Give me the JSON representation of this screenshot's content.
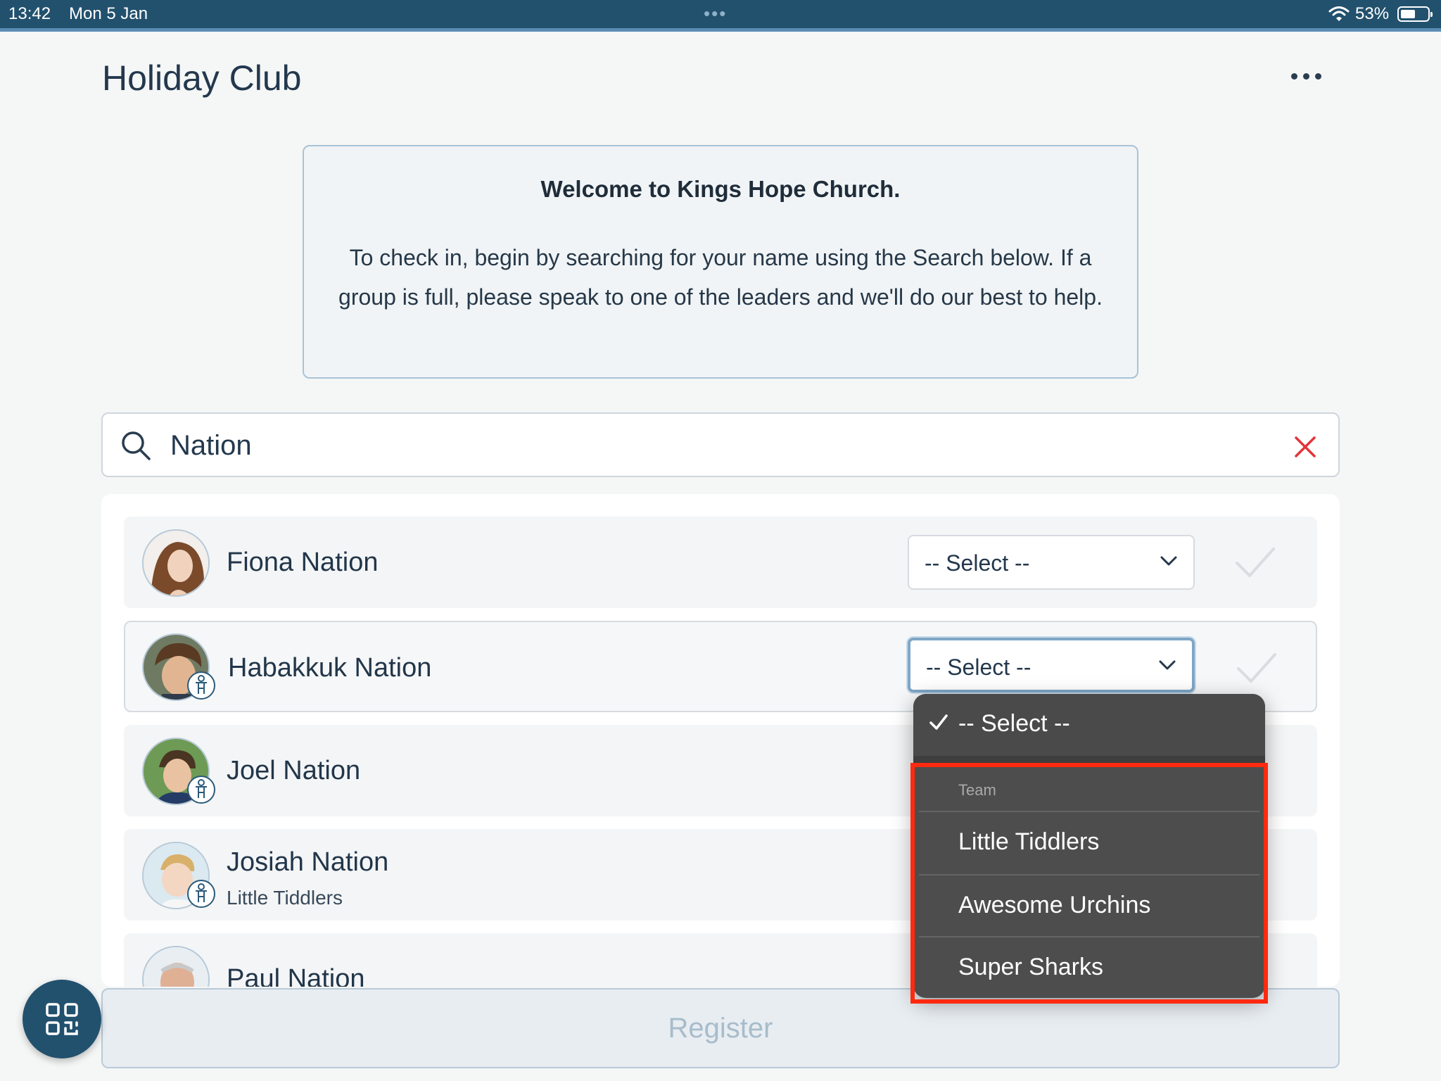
{
  "status_bar": {
    "time": "13:42",
    "date": "Mon 5 Jan",
    "battery": "53%",
    "battery_level": 0.53
  },
  "header": {
    "title": "Holiday Club"
  },
  "welcome": {
    "heading": "Welcome to Kings Hope Church.",
    "body": "To check in, begin by searching for your name using the Search below. If a group is full, please speak to one of the leaders and we'll do our best to help."
  },
  "search": {
    "value": "Nation"
  },
  "people": [
    {
      "name": "Fiona Nation",
      "group": "",
      "select": "-- Select --"
    },
    {
      "name": "Habakkuk Nation",
      "group": "",
      "select": "-- Select --"
    },
    {
      "name": "Joel Nation",
      "group": ""
    },
    {
      "name": "Josiah Nation",
      "group": "Little Tiddlers"
    },
    {
      "name": "Paul Nation",
      "group": ""
    }
  ],
  "dropdown": {
    "selected": "-- Select --",
    "group_header": "Team",
    "options": [
      "Little Tiddlers",
      "Awesome Urchins",
      "Super Sharks"
    ]
  },
  "register_label": "Register",
  "colors": {
    "accent": "#22516e",
    "clear": "#e2343a",
    "highlight": "#ff2a0f"
  }
}
